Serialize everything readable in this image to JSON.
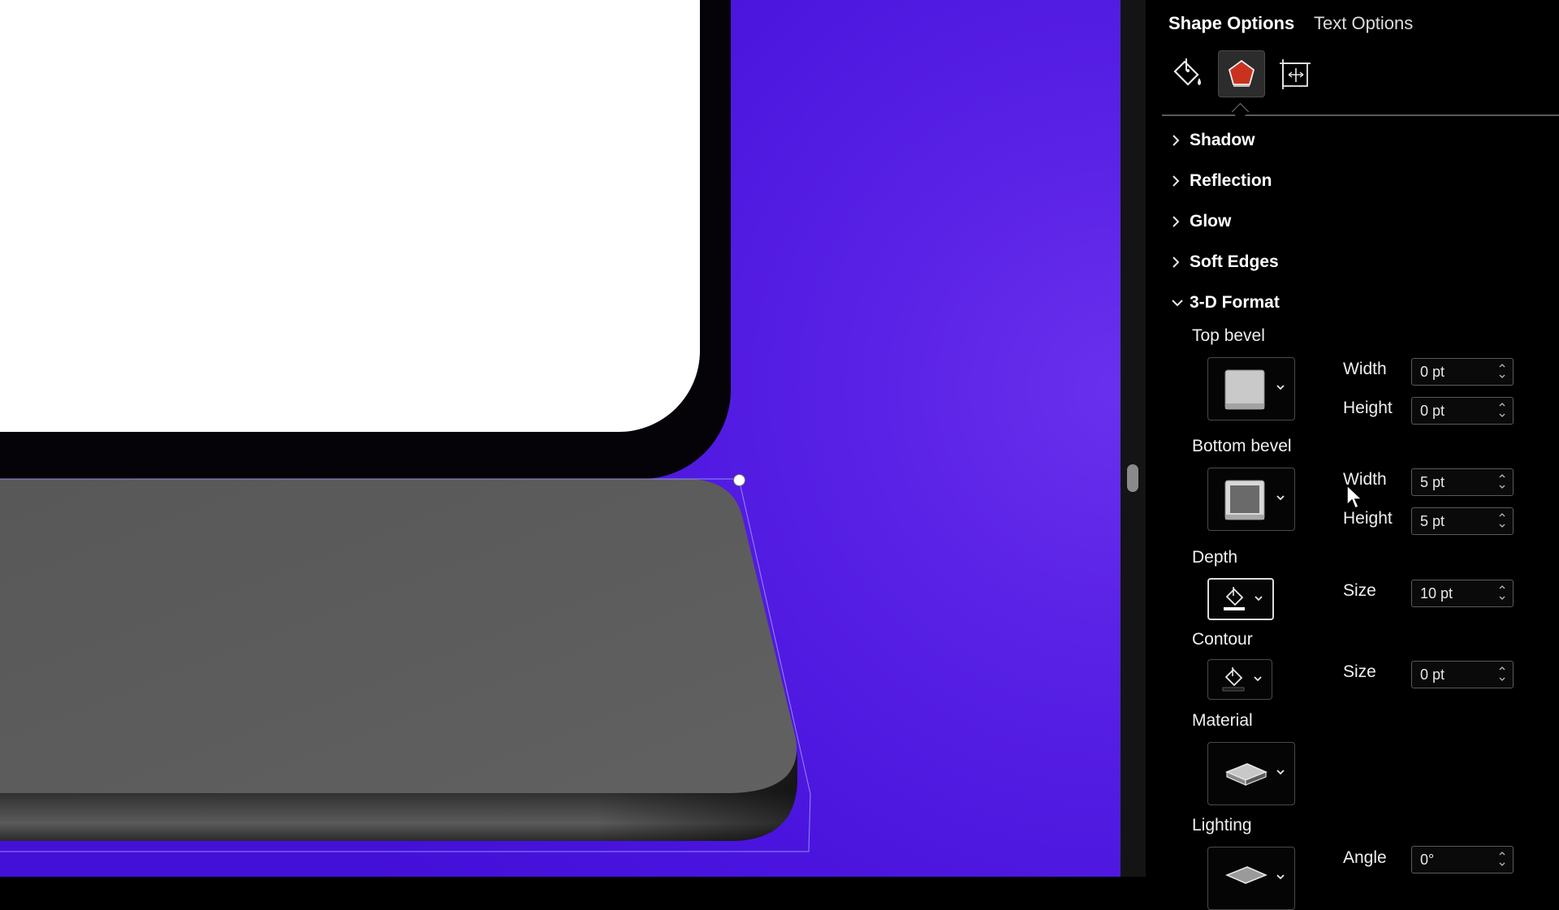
{
  "tabs": {
    "shape_options": "Shape Options",
    "text_options": "Text Options"
  },
  "category_icons": [
    "fill-line-icon",
    "effects-icon",
    "size-properties-icon"
  ],
  "sections": {
    "shadow": "Shadow",
    "reflection": "Reflection",
    "glow": "Glow",
    "soft_edges": "Soft Edges",
    "format_3d": "3-D Format"
  },
  "format3d": {
    "top_bevel": {
      "label": "Top bevel",
      "width_label": "Width",
      "width": "0 pt",
      "height_label": "Height",
      "height": "0 pt"
    },
    "bottom_bevel": {
      "label": "Bottom bevel",
      "width_label": "Width",
      "width": "5 pt",
      "height_label": "Height",
      "height": "5 pt"
    },
    "depth": {
      "label": "Depth",
      "size_label": "Size",
      "size": "10 pt"
    },
    "contour": {
      "label": "Contour",
      "size_label": "Size",
      "size": "0 pt"
    },
    "material": {
      "label": "Material"
    },
    "lighting": {
      "label": "Lighting",
      "angle_label": "Angle",
      "angle": "0°"
    }
  },
  "colors": {
    "canvas_purple": "#4a14de",
    "pane_background": "#000000",
    "effects_icon_red": "#c8321e",
    "shape_gray": "#5a5a5a"
  }
}
